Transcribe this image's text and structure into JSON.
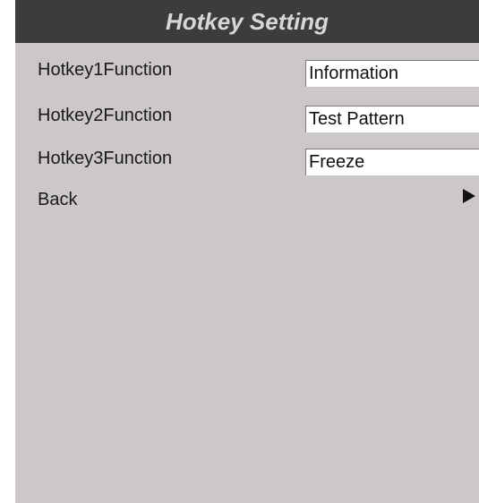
{
  "header": {
    "title": "Hotkey Setting"
  },
  "rows": [
    {
      "label": "Hotkey1Function",
      "value": "Information"
    },
    {
      "label": "Hotkey2Function",
      "value": "Test Pattern"
    },
    {
      "label": "Hotkey3Function",
      "value": "Freeze"
    }
  ],
  "back": {
    "label": "Back",
    "icon": "play-arrow-icon"
  },
  "colors": {
    "panel_bg": "#cbc8c7",
    "header_bg": "#3e3b3b",
    "header_text": "#d9d6d6",
    "value_bg": "#ffffff"
  }
}
